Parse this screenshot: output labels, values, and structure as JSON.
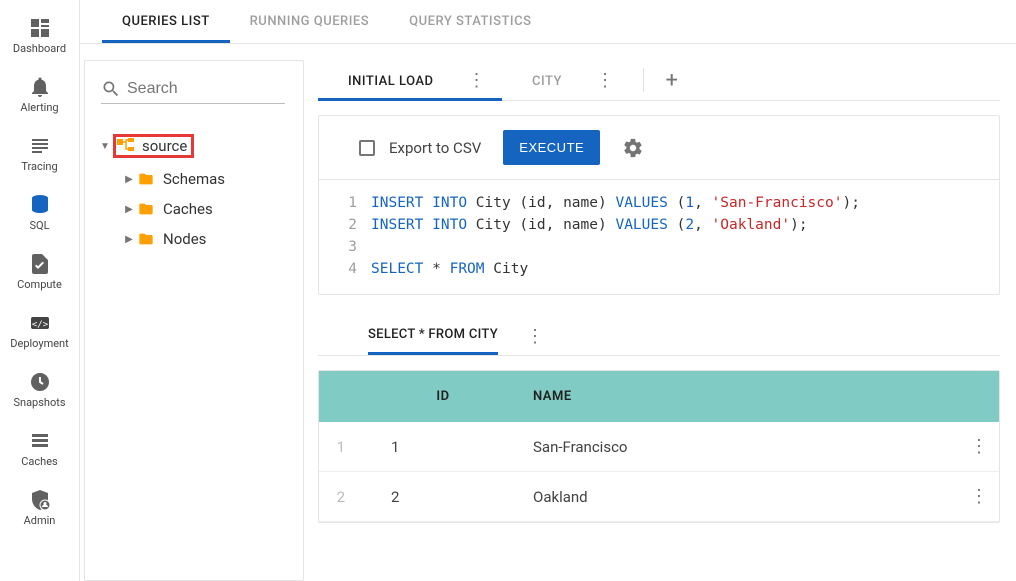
{
  "sidebar": {
    "items": [
      {
        "label": "Dashboard",
        "icon": "dashboard"
      },
      {
        "label": "Alerting",
        "icon": "bell"
      },
      {
        "label": "Tracing",
        "icon": "lines"
      },
      {
        "label": "SQL",
        "icon": "database",
        "active": true
      },
      {
        "label": "Compute",
        "icon": "filecheck"
      },
      {
        "label": "Deployment",
        "icon": "brackets"
      },
      {
        "label": "Snapshots",
        "icon": "clock"
      },
      {
        "label": "Caches",
        "icon": "stack"
      },
      {
        "label": "Admin",
        "icon": "shielduser"
      }
    ]
  },
  "top_tabs": [
    {
      "label": "QUERIES LIST",
      "active": true
    },
    {
      "label": "RUNNING QUERIES"
    },
    {
      "label": "QUERY STATISTICS"
    }
  ],
  "search": {
    "placeholder": "Search"
  },
  "tree": {
    "root": {
      "label": "source"
    },
    "children": [
      {
        "label": "Schemas"
      },
      {
        "label": "Caches"
      },
      {
        "label": "Nodes"
      }
    ]
  },
  "query_tabs": [
    {
      "label": "INITIAL LOAD",
      "active": true
    },
    {
      "label": "CITY"
    }
  ],
  "toolbar": {
    "export_label": "Export to CSV",
    "execute_label": "EXECUTE"
  },
  "editor": {
    "lines": [
      {
        "n": "1",
        "segments": [
          [
            "kw",
            "INSERT"
          ],
          [
            "sp",
            " "
          ],
          [
            "kw",
            "INTO"
          ],
          [
            "sp",
            " "
          ],
          [
            "t",
            "City (id, name) "
          ],
          [
            "kw",
            "VALUES"
          ],
          [
            "sp",
            " "
          ],
          [
            "t",
            "("
          ],
          [
            "num",
            "1"
          ],
          [
            "t",
            ", "
          ],
          [
            "str",
            "'San-Francisco'"
          ],
          [
            "t",
            ");"
          ]
        ]
      },
      {
        "n": "2",
        "segments": [
          [
            "kw",
            "INSERT"
          ],
          [
            "sp",
            " "
          ],
          [
            "kw",
            "INTO"
          ],
          [
            "sp",
            " "
          ],
          [
            "t",
            "City (id, name) "
          ],
          [
            "kw",
            "VALUES"
          ],
          [
            "sp",
            " "
          ],
          [
            "t",
            "("
          ],
          [
            "num",
            "2"
          ],
          [
            "t",
            ", "
          ],
          [
            "str",
            "'Oakland'"
          ],
          [
            "t",
            ");"
          ]
        ]
      },
      {
        "n": "3",
        "segments": []
      },
      {
        "n": "4",
        "segments": [
          [
            "kw",
            "SELECT"
          ],
          [
            "sp",
            " "
          ],
          [
            "t",
            "* "
          ],
          [
            "kw",
            "FROM"
          ],
          [
            "sp",
            " "
          ],
          [
            "t",
            "City"
          ]
        ]
      }
    ]
  },
  "results": {
    "tab_label": "SELECT * FROM CITY",
    "columns": [
      "ID",
      "NAME"
    ],
    "rows": [
      {
        "n": "1",
        "id": "1",
        "name": "San-Francisco"
      },
      {
        "n": "2",
        "id": "2",
        "name": "Oakland"
      }
    ]
  }
}
